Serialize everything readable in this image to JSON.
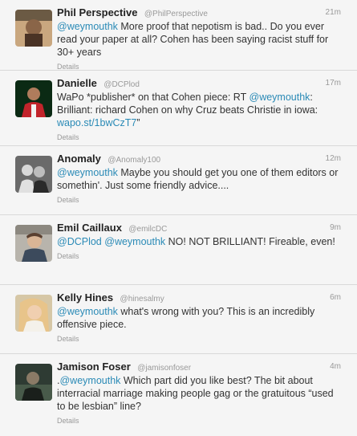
{
  "tweets": [
    {
      "fullname": "Phil Perspective",
      "username": "@PhilPerspective",
      "time": "21m",
      "parts": [
        {
          "t": "@weymouthk",
          "k": "mention"
        },
        {
          "t": " More proof that nepotism is bad..  Do you ever read your paper at all?  Cohen has been saying racist stuff for 30+ years",
          "k": "text"
        }
      ],
      "details": "Details",
      "avatar": {
        "bg": "#c9a77f",
        "fg": "#4a3325"
      }
    },
    {
      "fullname": "Danielle",
      "username": "@DCPlod",
      "time": "17m",
      "parts": [
        {
          "t": "WaPo *publisher* on that Cohen piece: RT ",
          "k": "text"
        },
        {
          "t": "@weymouthk",
          "k": "mention"
        },
        {
          "t": ": Brilliant:  richard Cohen on why Cruz beats Christie in iowa: ",
          "k": "text"
        },
        {
          "t": "wapo.st/1bwCzT7",
          "k": "link"
        },
        {
          "t": "”",
          "k": "text"
        }
      ],
      "details": "Details",
      "avatar": {
        "bg": "#0b2a14",
        "fg": "#c2242b"
      }
    },
    {
      "fullname": "Anomaly",
      "username": "@Anomaly100",
      "time": "12m",
      "parts": [
        {
          "t": "@weymouthk",
          "k": "mention"
        },
        {
          "t": " Maybe you should get you one of them editors or somethin'. Just some friendly advice....",
          "k": "text"
        }
      ],
      "details": "Details",
      "avatar": {
        "bg": "#6a6a6a",
        "fg": "#e0e0e0"
      }
    },
    {
      "fullname": "Emil Caillaux",
      "username": "@emilcDC",
      "time": "9m",
      "parts": [
        {
          "t": "@DCPlod",
          "k": "mention"
        },
        {
          "t": " ",
          "k": "text"
        },
        {
          "t": "@weymouthk",
          "k": "mention"
        },
        {
          "t": " NO! NOT BRILLIANT! Fireable, even!",
          "k": "text"
        }
      ],
      "details": "Details",
      "avatar": {
        "bg": "#b8b4ac",
        "fg": "#5a4030"
      }
    },
    {
      "fullname": "Kelly Hines",
      "username": "@hinesalmy",
      "time": "6m",
      "parts": [
        {
          "t": "@weymouthk",
          "k": "mention"
        },
        {
          "t": " what's wrong with you? This is an incredibly offensive piece.",
          "k": "text"
        }
      ],
      "details": "Details",
      "avatar": {
        "bg": "#d6c7a6",
        "fg": "#e8c48a"
      }
    },
    {
      "fullname": "Jamison Foser",
      "username": "@jamisonfoser",
      "time": "4m",
      "parts": [
        {
          "t": ".",
          "k": "text"
        },
        {
          "t": "@weymouthk",
          "k": "mention"
        },
        {
          "t": " Which part did you like best? The bit about interracial marriage making people gag or the gratuitous “used to be lesbian” line?",
          "k": "text"
        }
      ],
      "details": "Details",
      "avatar": {
        "bg": "#2e3b33",
        "fg": "#6a7f6a"
      }
    }
  ]
}
